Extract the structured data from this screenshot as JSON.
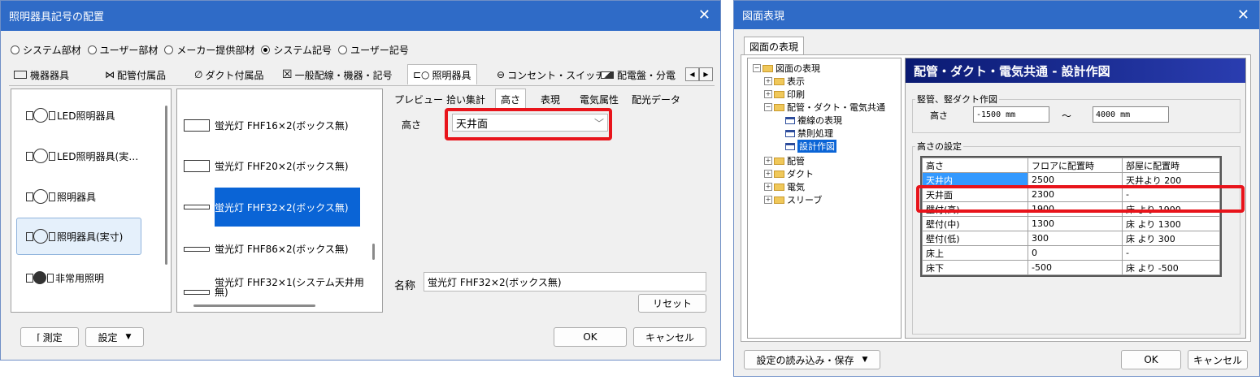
{
  "dialog1": {
    "title": "照明器具記号の配置",
    "radios": [
      {
        "label": "システム部材",
        "checked": false
      },
      {
        "label": "ユーザー部材",
        "checked": false
      },
      {
        "label": "メーカー提供部材",
        "checked": false
      },
      {
        "label": "システム記号",
        "checked": true
      },
      {
        "label": "ユーザー記号",
        "checked": false
      }
    ],
    "category_tabs": [
      "機器器具",
      "配管付属品",
      "ダクト付属品",
      "一般配線・機器・記号",
      "照明器具",
      "コンセント・スイッチ",
      "配電盤・分電"
    ],
    "symbols": [
      "LED照明器具",
      "LED照明器具(実…",
      "照明器具",
      "照明器具(実寸)",
      "非常用照明"
    ],
    "items": [
      "蛍光灯 FHF16×2(ボックス無)",
      "蛍光灯 FHF20×2(ボックス無)",
      "蛍光灯 FHF32×2(ボックス無)",
      "蛍光灯 FHF86×2(ボックス無)",
      "蛍光灯 FHF32×1(システム天井用",
      "無)"
    ],
    "prop_tabs": [
      "プレビュー",
      "拾い集計",
      "高さ",
      "表現",
      "電気属性",
      "配光データ"
    ],
    "height_label": "高さ",
    "height_value": "天井面",
    "name_label": "名称",
    "name_value": "蛍光灯 FHF32×2(ボックス無)",
    "reset": "リセット",
    "measure": "測定",
    "settings": "設定",
    "ok": "OK",
    "cancel": "キャンセル"
  },
  "dialog2": {
    "title": "図面表現",
    "tab": "図面の表現",
    "tree": {
      "root": "図面の表現",
      "items": [
        "表示",
        "印刷",
        "配管・ダクト・電気共通",
        "複線の表現",
        "禁則処理",
        "設計作図",
        "配管",
        "ダクト",
        "電気",
        "スリーブ"
      ]
    },
    "header": "配管・ダクト・電気共通 - 設計作図",
    "group1": "竪管、竪ダクト作図",
    "height_label": "高さ",
    "from_value": "-1500 mm",
    "tilde": "～",
    "to_value": "4000 mm",
    "group2": "高さの設定",
    "table_headers": [
      "高さ",
      "フロアに配置時",
      "部屋に配置時"
    ],
    "table_rows": [
      [
        "天井内",
        "2500",
        "天井より 200"
      ],
      [
        "天井面",
        "2300",
        "-"
      ],
      [
        "壁付(高)",
        "1900",
        "床 より 1900"
      ],
      [
        "壁付(中)",
        "1300",
        "床 より 1300"
      ],
      [
        "壁付(低)",
        "300",
        "床 より 300"
      ],
      [
        "床上",
        "0",
        "-"
      ],
      [
        "床下",
        "-500",
        "床 より -500"
      ]
    ],
    "load_save": "設定の読み込み・保存",
    "ok": "OK",
    "cancel": "キャンセル"
  }
}
